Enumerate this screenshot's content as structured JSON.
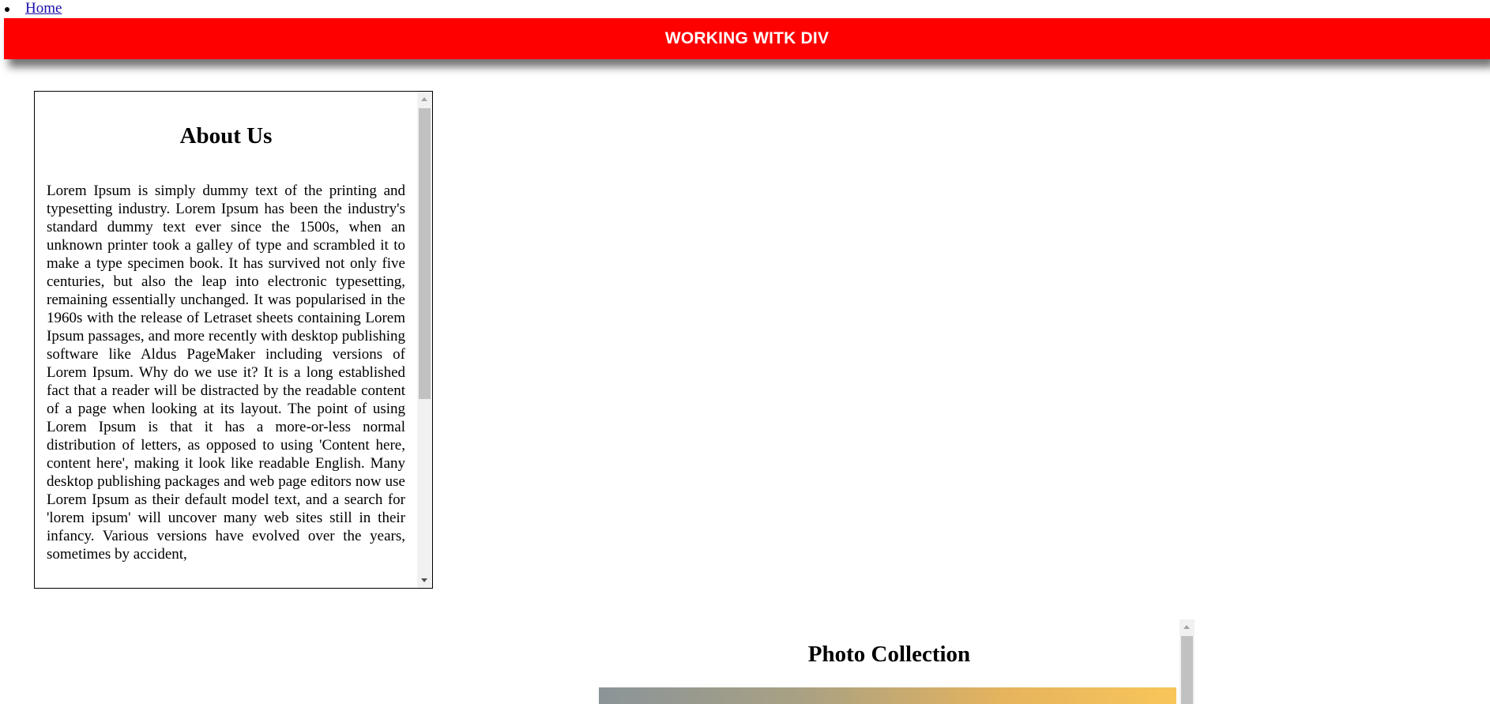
{
  "nav": {
    "items": [
      {
        "label": "Home"
      }
    ]
  },
  "header": {
    "title": "WORKING WITK DIV",
    "background": "#ff0000"
  },
  "about": {
    "title": "About Us",
    "text": "Lorem Ipsum is simply dummy text of the printing and typesetting industry. Lorem Ipsum has been the industry's standard dummy text ever since the 1500s, when an unknown printer took a galley of type and scrambled it to make a type specimen book. It has survived not only five centuries, but also the leap into electronic typesetting, remaining essentially unchanged. It was popularised in the 1960s with the release of Letraset sheets containing Lorem Ipsum passages, and more recently with desktop publishing software like Aldus PageMaker including versions of Lorem Ipsum. Why do we use it? It is a long established fact that a reader will be distracted by the readable content of a page when looking at its layout. The point of using Lorem Ipsum is that it has a more-or-less normal distribution of letters, as opposed to using 'Content here, content here', making it look like readable English. Many desktop publishing packages and web page editors now use Lorem Ipsum as their default model text, and a search for 'lorem ipsum' will uncover many web sites still in their infancy. Various versions have evolved over the years, sometimes by accident,"
  },
  "photos": {
    "title": "Photo Collection"
  }
}
